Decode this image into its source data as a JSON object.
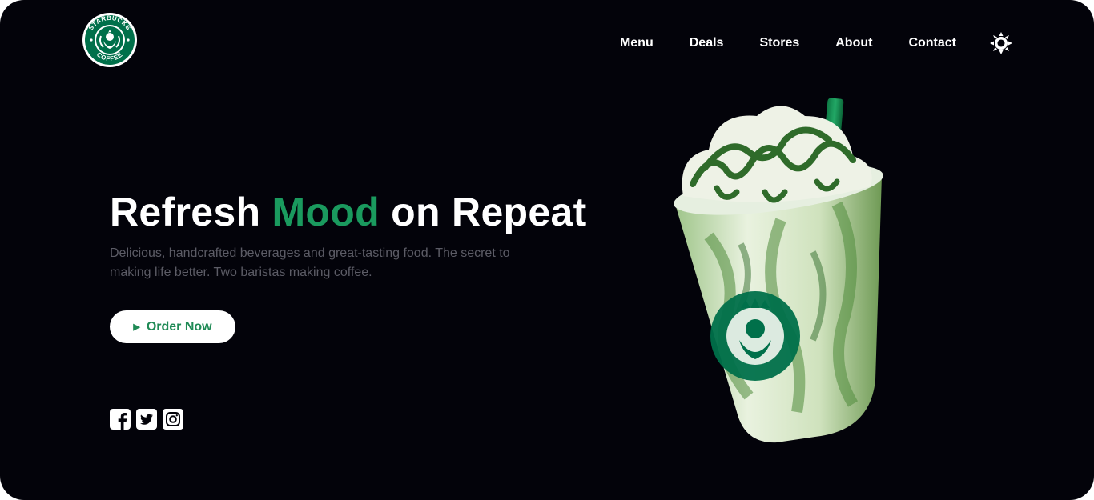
{
  "brand": {
    "logo_ring_text": "STARBUCKS COFFEE",
    "color": "#00704a"
  },
  "nav": {
    "items": [
      {
        "label": "Menu"
      },
      {
        "label": "Deals"
      },
      {
        "label": "Stores"
      },
      {
        "label": "About"
      },
      {
        "label": "Contact"
      }
    ],
    "theme_icon": "sun-icon"
  },
  "hero": {
    "title_part1": "Refresh ",
    "title_accent": "Mood",
    "title_part2": " on Repeat",
    "description": "Delicious, handcrafted beverages and great-tasting food. The secret to making life better. Two baristas making coffee.",
    "cta_label": "Order Now",
    "cta_icon": "play-icon"
  },
  "socials": [
    {
      "icon": "facebook-icon"
    },
    {
      "icon": "twitter-icon"
    },
    {
      "icon": "instagram-icon"
    }
  ],
  "colors": {
    "background": "#03030a",
    "accent": "#1a9a5e",
    "text": "#ffffff",
    "muted": "#5c5c66"
  }
}
